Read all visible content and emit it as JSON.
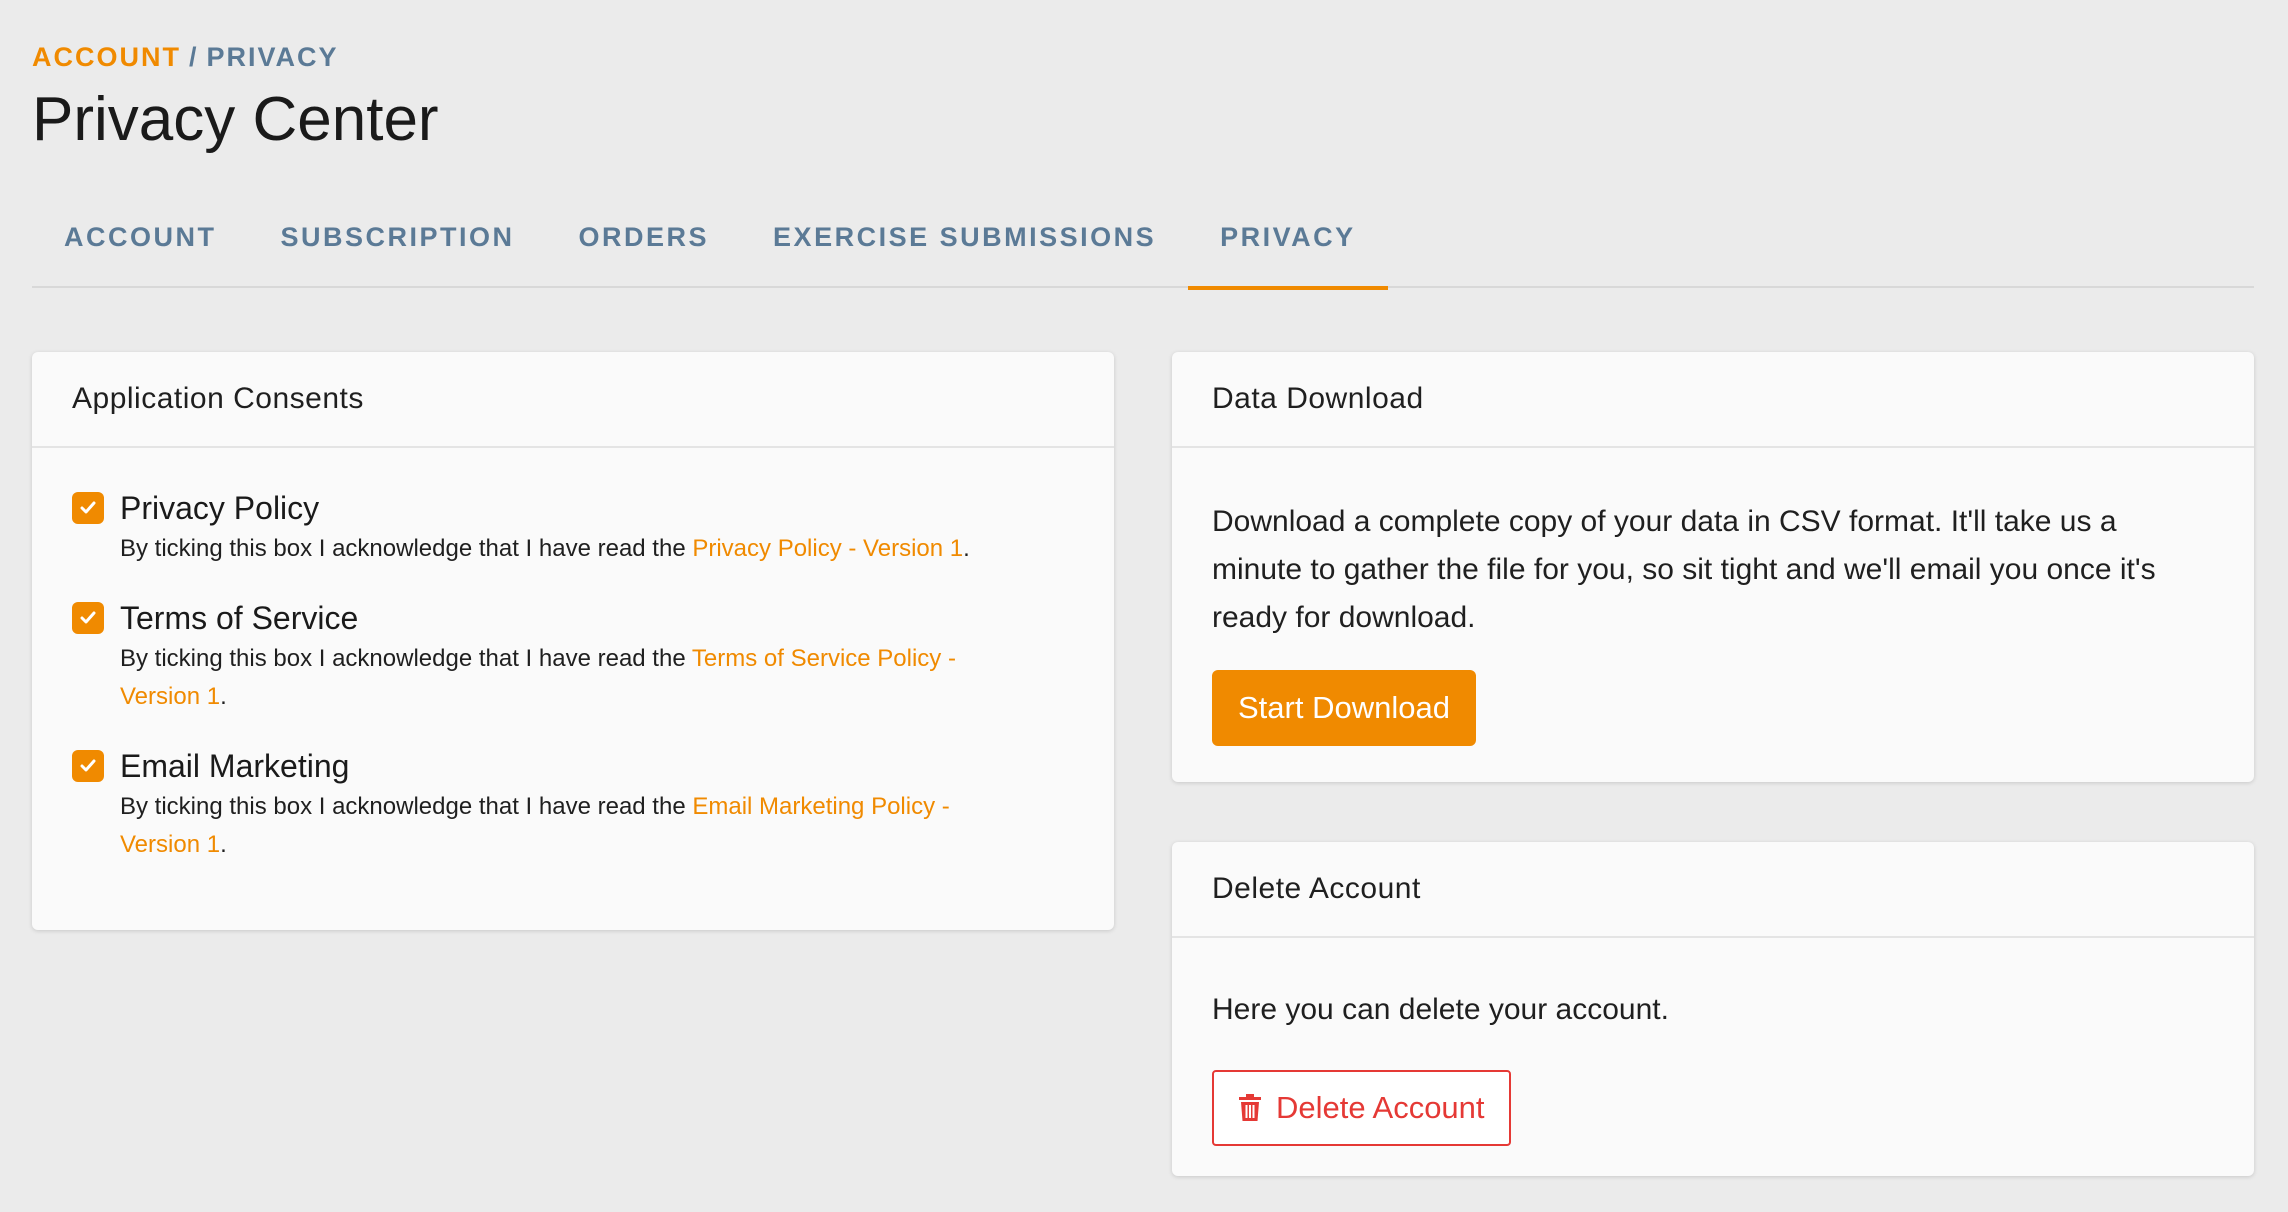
{
  "breadcrumb": {
    "parent": "ACCOUNT",
    "separator": "/",
    "current": "PRIVACY"
  },
  "page_title": "Privacy Center",
  "tabs": [
    {
      "label": "ACCOUNT"
    },
    {
      "label": "SUBSCRIPTION"
    },
    {
      "label": "ORDERS"
    },
    {
      "label": "EXERCISE SUBMISSIONS"
    },
    {
      "label": "PRIVACY",
      "active": true
    }
  ],
  "consents": {
    "title": "Application Consents",
    "items": [
      {
        "label": "Privacy Policy",
        "checked": true,
        "desc_prefix": "By ticking this box I acknowledge that I have read the ",
        "link": "Privacy Policy - Version 1",
        "desc_suffix": "."
      },
      {
        "label": "Terms of Service",
        "checked": true,
        "desc_prefix": "By ticking this box I acknowledge that I have read the ",
        "link": "Terms of Service Policy - Version 1",
        "desc_suffix": "."
      },
      {
        "label": "Email Marketing",
        "checked": true,
        "desc_prefix": "By ticking this box I acknowledge that I have read the ",
        "link": "Email Marketing Policy - Version 1",
        "desc_suffix": "."
      }
    ]
  },
  "download": {
    "title": "Data Download",
    "text": "Download a complete copy of your data in CSV format. It'll take us a minute to gather the file for you, so sit tight and we'll email you once it's ready for download.",
    "button": "Start Download"
  },
  "delete": {
    "title": "Delete Account",
    "text": "Here you can delete your account.",
    "button": "Delete Account",
    "icon": "trash-icon"
  },
  "colors": {
    "accent": "#f08a00",
    "tab_text": "#5b7a96",
    "danger": "#e53935",
    "background": "#ebebeb"
  }
}
